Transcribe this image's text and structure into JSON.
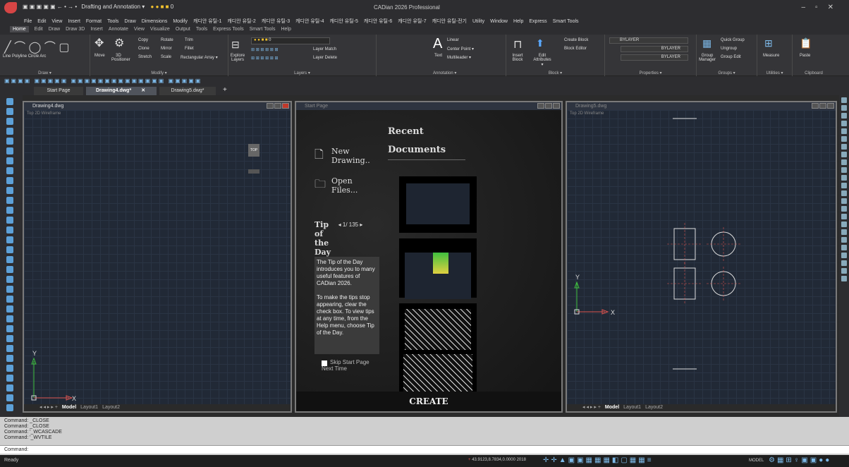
{
  "app": {
    "title": "CADian 2026 Professional",
    "workspace": "Drafting and Annotation",
    "layer_quick": "0"
  },
  "menu": [
    "File",
    "Edit",
    "View",
    "Insert",
    "Format",
    "Tools",
    "Draw",
    "Dimensions",
    "Modify",
    "캐디안 유틸-1",
    "캐디안 유틸-2",
    "캐디안 유틸-3",
    "캐디안 유틸-4",
    "캐디안 유틸-5",
    "캐디안 유틸-6",
    "캐디안 유틸-7",
    "캐디안 유틸-전기",
    "Utility",
    "Window",
    "Help",
    "Express",
    "Smart Tools"
  ],
  "ribbon_tabs": [
    "Home",
    "Edit",
    "Draw",
    "Draw 3D",
    "Insert",
    "Annotate",
    "View",
    "Visualize",
    "Output",
    "Tools",
    "Express Tools",
    "Smart Tools",
    "Help"
  ],
  "ribbon": {
    "draw": {
      "label": "Draw ▾",
      "items": [
        "Line",
        "Polyline",
        "Circle",
        "Arc"
      ]
    },
    "modify": {
      "label": "Modify ▾",
      "move": "Move",
      "positioner": "3D Positioner",
      "copy": "Copy",
      "rotate": "Rotate",
      "trim": "Trim",
      "clone": "Clone",
      "mirror": "Mirror",
      "fillet": "Fillet",
      "stretch": "Stretch",
      "scale": "Scale",
      "rect_array": "Rectangular Array ▾"
    },
    "layers": {
      "label": "Layers ▾",
      "explore": "Explore Layers",
      "layer_match": "Layer Match",
      "layer_delete": "Layer Delete",
      "current": "0"
    },
    "annotation": {
      "label": "Annotation ▾",
      "text": "Text",
      "linear": "Linear",
      "center_point": "Center Point ▾",
      "multileader": "Multileader ▾"
    },
    "block": {
      "label": "Block ▾",
      "insert": "Insert Block",
      "create": "Create Block",
      "editor": "Block Editor",
      "edit_attr": "Edit Attributes ▾"
    },
    "properties": {
      "label": "Properties ▾",
      "bylayer1": "BYLAYER",
      "bylayer2": "BYLAYER",
      "bylayer3": "BYLAYER"
    },
    "groups": {
      "label": "Groups ▾",
      "manager": "Group Manager",
      "quick": "Quick Group",
      "ungroup": "Ungroup",
      "edit": "Group Edit"
    },
    "utilities": {
      "label": "Utilities ▾",
      "measure": "Measure"
    },
    "clipboard": {
      "label": "Clipboard",
      "paste": "Paste"
    }
  },
  "doc_tabs": [
    "Start Page",
    "Drawing4.dwg*",
    "Drawing5.dwg*",
    "+"
  ],
  "win1": {
    "title": "Drawing4.dwg",
    "sub": "Top   2D Wireframe",
    "cube": "TOP",
    "tabs": [
      "Model",
      "Layout1",
      "Layout2"
    ]
  },
  "win2": {
    "title": "Start Page",
    "recent": "Recent Documents",
    "new": "New Drawing..",
    "open": "Open Files...",
    "tip": "Tip of the Day",
    "tip_count": "1/ 135",
    "tip_text": "The Tip of the Day introduces you to many useful features of CADian 2026.\n\nTo make the tips stop appearing, clear the check box. To view tips at any time, from the Help menu, choose Tip of the Day.",
    "skip": "Skip Start Page Next Time",
    "create": "CREATE"
  },
  "win3": {
    "title": "Drawing5.dwg",
    "sub": "Top   2D Wireframe",
    "tabs": [
      "Model",
      "Layout1",
      "Layout2"
    ]
  },
  "cmd": [
    "Command: _CLOSE",
    "Command: _CLOSE",
    "Command: '_WCASCADE",
    "Command: '_WVTILE"
  ],
  "cmd_prompt": "Command:",
  "status": {
    "ready": "Ready",
    "coords": "43.9123,8.7834,0.0000",
    "year": "2018",
    "model": "MODEL"
  },
  "colors": {
    "accent": "#d9534f",
    "grid": "#212936",
    "ucs": "#3fbf3f"
  }
}
